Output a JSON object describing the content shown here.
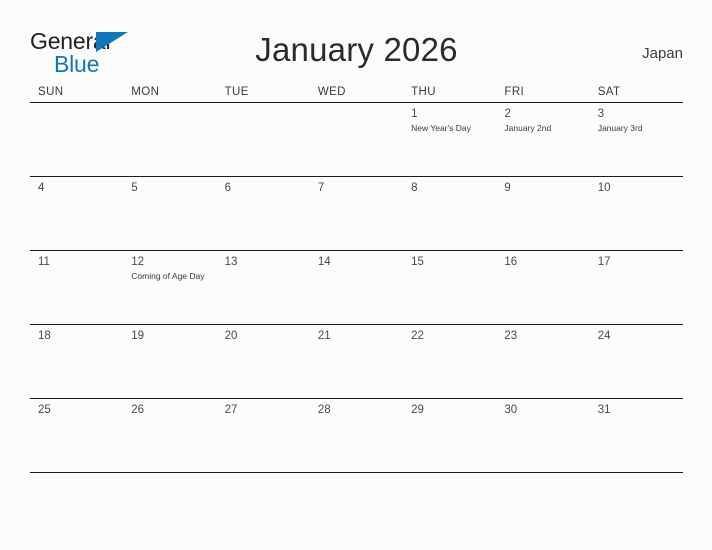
{
  "brand": {
    "name_part1": "General",
    "name_part2": "Blue",
    "color_dark": "#231f20",
    "color_blue": "#1076bc"
  },
  "header": {
    "title": "January 2026",
    "region": "Japan"
  },
  "calendar": {
    "month": "January",
    "year": "2026",
    "weekday_headers": [
      "SUN",
      "MON",
      "TUE",
      "WED",
      "THU",
      "FRI",
      "SAT"
    ],
    "weeks": [
      [
        {
          "day": "",
          "event": ""
        },
        {
          "day": "",
          "event": ""
        },
        {
          "day": "",
          "event": ""
        },
        {
          "day": "",
          "event": ""
        },
        {
          "day": "1",
          "event": "New Year's Day"
        },
        {
          "day": "2",
          "event": "January 2nd"
        },
        {
          "day": "3",
          "event": "January 3rd"
        }
      ],
      [
        {
          "day": "4",
          "event": ""
        },
        {
          "day": "5",
          "event": ""
        },
        {
          "day": "6",
          "event": ""
        },
        {
          "day": "7",
          "event": ""
        },
        {
          "day": "8",
          "event": ""
        },
        {
          "day": "9",
          "event": ""
        },
        {
          "day": "10",
          "event": ""
        }
      ],
      [
        {
          "day": "11",
          "event": ""
        },
        {
          "day": "12",
          "event": "Coming of Age Day"
        },
        {
          "day": "13",
          "event": ""
        },
        {
          "day": "14",
          "event": ""
        },
        {
          "day": "15",
          "event": ""
        },
        {
          "day": "16",
          "event": ""
        },
        {
          "day": "17",
          "event": ""
        }
      ],
      [
        {
          "day": "18",
          "event": ""
        },
        {
          "day": "19",
          "event": ""
        },
        {
          "day": "20",
          "event": ""
        },
        {
          "day": "21",
          "event": ""
        },
        {
          "day": "22",
          "event": ""
        },
        {
          "day": "23",
          "event": ""
        },
        {
          "day": "24",
          "event": ""
        }
      ],
      [
        {
          "day": "25",
          "event": ""
        },
        {
          "day": "26",
          "event": ""
        },
        {
          "day": "27",
          "event": ""
        },
        {
          "day": "28",
          "event": ""
        },
        {
          "day": "29",
          "event": ""
        },
        {
          "day": "30",
          "event": ""
        },
        {
          "day": "31",
          "event": ""
        }
      ]
    ]
  }
}
